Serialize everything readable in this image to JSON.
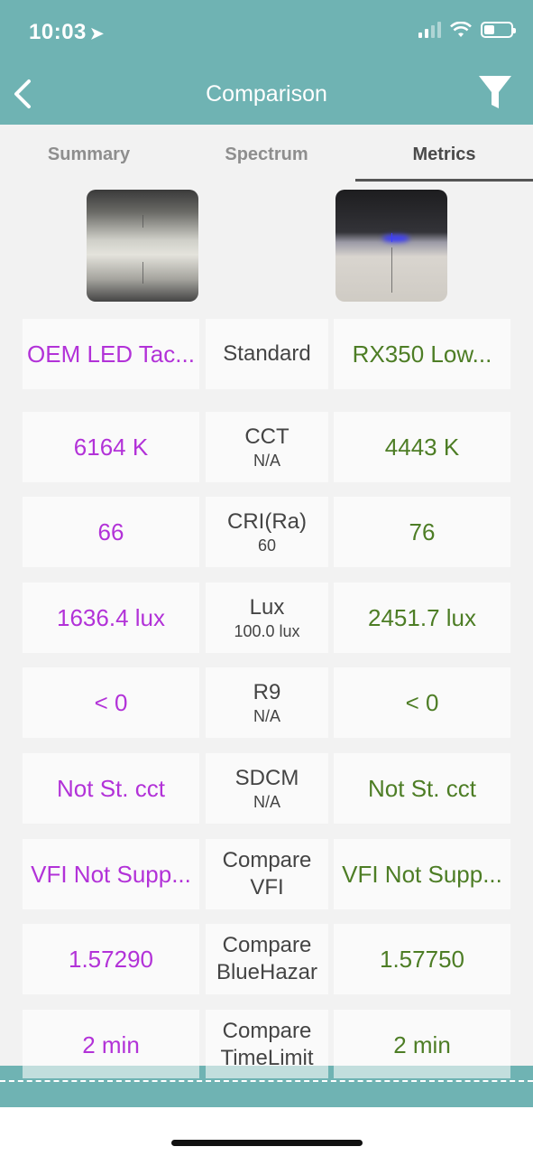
{
  "status_bar": {
    "time": "10:03"
  },
  "nav": {
    "title": "Comparison"
  },
  "tabs": [
    {
      "label": "Summary"
    },
    {
      "label": "Spectrum"
    },
    {
      "label": "Metrics"
    }
  ],
  "header_row": {
    "left": "OEM LED Tac...",
    "center": "Standard",
    "right": "RX350 Low..."
  },
  "rows": [
    {
      "label": "CCT",
      "standard": "N/A",
      "left": "6164 K",
      "right": "4443 K"
    },
    {
      "label": "CRI(Ra)",
      "standard": "60",
      "left": "66",
      "right": "76"
    },
    {
      "label": "Lux",
      "standard": "100.0 lux",
      "left": "1636.4 lux",
      "right": "2451.7 lux"
    },
    {
      "label": "R9",
      "standard": "N/A",
      "left": "< 0",
      "right": "< 0"
    },
    {
      "label": "SDCM",
      "standard": "N/A",
      "left": "Not St. cct",
      "right": "Not St. cct"
    },
    {
      "label": "Compare VFI",
      "label_line1": "Compare",
      "label_line2": "VFI",
      "left": "VFI Not Supp...",
      "right": "VFI Not Supp..."
    },
    {
      "label_line1": "Compare",
      "label_line2": "BlueHazar",
      "left": "1.57290",
      "right": "1.57750"
    },
    {
      "label_line1": "Compare",
      "label_line2": "TimeLimit",
      "left": "2 min",
      "right": "2 min"
    }
  ],
  "colors": {
    "header": "#6fb3b3",
    "left_value": "#b232d8",
    "right_value": "#4d7d25",
    "background": "#f2f2f2"
  },
  "icons": {
    "back": "chevron-left-icon",
    "filter": "filter-funnel-icon",
    "location": "location-arrow-icon",
    "wifi": "wifi-icon",
    "battery": "battery-icon",
    "signal": "cellular-signal-icon"
  }
}
